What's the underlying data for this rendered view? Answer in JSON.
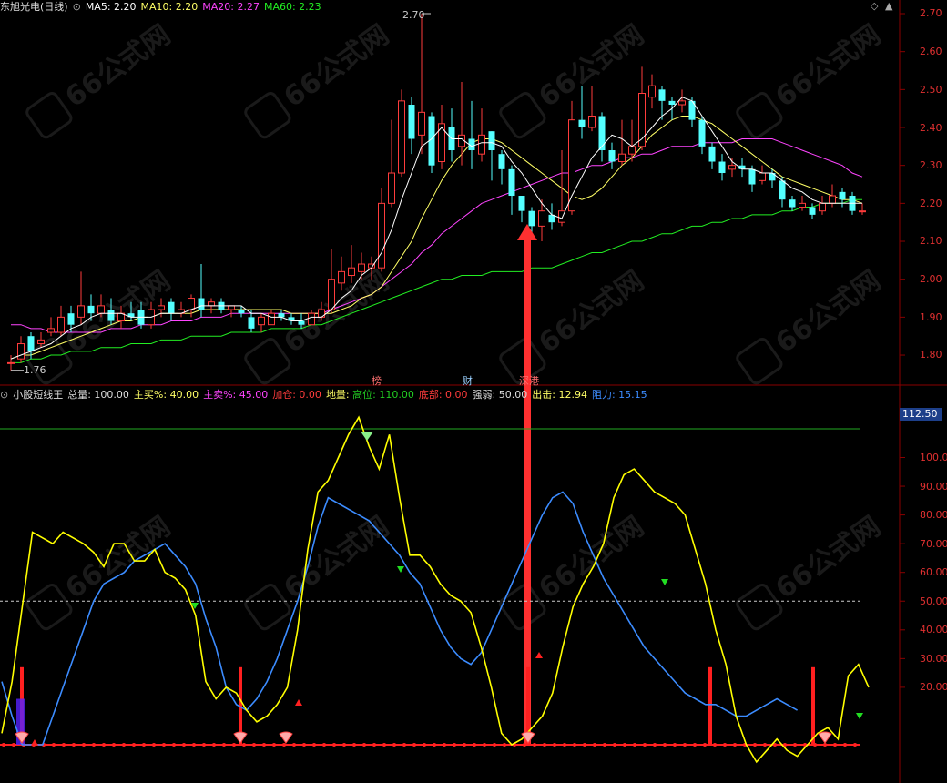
{
  "main_header": {
    "stock_name": "东旭光电(日线)",
    "ma5": "MA5: 2.20",
    "ma10": "MA10: 2.20",
    "ma20": "MA20: 2.27",
    "ma60": "MA60: 2.23"
  },
  "sub_header": {
    "indicator_name": "小股短线王",
    "total": "总量: 100.00",
    "main_buy": "主买%: 40.00",
    "main_sell": "主卖%: 45.00",
    "add_pos": "加仓: 0.00",
    "floor": "地量: ",
    "high_pos": "高位: 110.00",
    "bottom": "底部: 0.00",
    "strength": "强弱: 50.00",
    "strike": "出击: 12.94",
    "resistance": "阻力: 15.15"
  },
  "price_axis": [
    "2.70",
    "2.60",
    "2.50",
    "2.40",
    "2.30",
    "2.20",
    "2.10",
    "2.00",
    "1.90",
    "1.80"
  ],
  "indicator_axis": [
    "100.0",
    "90.00",
    "80.00",
    "70.00",
    "60.00",
    "50.00",
    "40.00",
    "30.00",
    "20.00"
  ],
  "indicator_axis_box": "112.50",
  "annotations": {
    "high_label": "2.70",
    "low_label": "1.76",
    "event_bang": "榜",
    "event_cai": "财",
    "event_tong": "深港"
  },
  "watermark_text": "66公式网",
  "colors": {
    "background": "#000000",
    "up_candle": "#ff3c3c",
    "down_candle": "#54ffff",
    "ma5": "#ffffff",
    "ma10": "#ffff66",
    "ma20": "#ff44ff",
    "ma60": "#22ee22",
    "grid": "#7a0000",
    "yellow_line": "#ffff00",
    "blue_line": "#3c8cff",
    "signal_red": "#ff2020"
  },
  "chart_data": [
    {
      "type": "candlestick",
      "name": "东旭光电(日线)",
      "ylim": [
        1.74,
        2.75
      ],
      "candles": [
        [
          1.78,
          1.78,
          1.8,
          1.76
        ],
        [
          1.79,
          1.83,
          1.85,
          1.78
        ],
        [
          1.85,
          1.81,
          1.86,
          1.79
        ],
        [
          1.83,
          1.84,
          1.86,
          1.82
        ],
        [
          1.86,
          1.87,
          1.9,
          1.85
        ],
        [
          1.86,
          1.9,
          1.93,
          1.85
        ],
        [
          1.91,
          1.88,
          1.93,
          1.86
        ],
        [
          1.9,
          1.93,
          2.02,
          1.88
        ],
        [
          1.93,
          1.91,
          1.96,
          1.89
        ],
        [
          1.91,
          1.93,
          1.96,
          1.9
        ],
        [
          1.92,
          1.89,
          1.95,
          1.88
        ],
        [
          1.89,
          1.91,
          1.93,
          1.87
        ],
        [
          1.91,
          1.9,
          1.94,
          1.89
        ],
        [
          1.92,
          1.88,
          1.94,
          1.87
        ],
        [
          1.88,
          1.92,
          1.94,
          1.87
        ],
        [
          1.92,
          1.93,
          1.95,
          1.9
        ],
        [
          1.94,
          1.91,
          1.95,
          1.89
        ],
        [
          1.91,
          1.92,
          1.94,
          1.9
        ],
        [
          1.92,
          1.95,
          1.96,
          1.9
        ],
        [
          1.95,
          1.92,
          2.04,
          1.9
        ],
        [
          1.93,
          1.94,
          1.95,
          1.91
        ],
        [
          1.94,
          1.92,
          1.95,
          1.91
        ],
        [
          1.92,
          1.93,
          1.93,
          1.9
        ],
        [
          1.92,
          1.91,
          1.93,
          1.9
        ],
        [
          1.9,
          1.87,
          1.92,
          1.86
        ],
        [
          1.88,
          1.9,
          1.91,
          1.86
        ],
        [
          1.88,
          1.91,
          1.92,
          1.88
        ],
        [
          1.91,
          1.9,
          1.92,
          1.89
        ],
        [
          1.9,
          1.89,
          1.91,
          1.88
        ],
        [
          1.89,
          1.88,
          1.91,
          1.87
        ],
        [
          1.88,
          1.91,
          1.92,
          1.88
        ],
        [
          1.9,
          1.92,
          1.94,
          1.89
        ],
        [
          1.92,
          2.0,
          2.08,
          1.91
        ],
        [
          1.99,
          2.02,
          2.06,
          1.97
        ],
        [
          2.01,
          2.03,
          2.09,
          1.99
        ],
        [
          2.02,
          2.04,
          2.07,
          2.0
        ],
        [
          2.03,
          2.04,
          2.06,
          2.0
        ],
        [
          2.03,
          2.2,
          2.24,
          2.02
        ],
        [
          2.2,
          2.28,
          2.42,
          2.19
        ],
        [
          2.28,
          2.47,
          2.5,
          2.27
        ],
        [
          2.46,
          2.37,
          2.48,
          2.33
        ],
        [
          2.38,
          2.44,
          2.7,
          2.33
        ],
        [
          2.43,
          2.3,
          2.44,
          2.28
        ],
        [
          2.31,
          2.41,
          2.46,
          2.29
        ],
        [
          2.4,
          2.34,
          2.45,
          2.31
        ],
        [
          2.35,
          2.38,
          2.52,
          2.3
        ],
        [
          2.37,
          2.34,
          2.47,
          2.29
        ],
        [
          2.33,
          2.38,
          2.45,
          2.31
        ],
        [
          2.39,
          2.34,
          2.39,
          2.26
        ],
        [
          2.33,
          2.29,
          2.34,
          2.25
        ],
        [
          2.29,
          2.22,
          2.3,
          2.17
        ],
        [
          2.22,
          2.18,
          2.22,
          2.15
        ],
        [
          2.18,
          2.14,
          2.19,
          2.12
        ],
        [
          2.14,
          2.18,
          2.21,
          2.1
        ],
        [
          2.17,
          2.15,
          2.2,
          2.13
        ],
        [
          2.15,
          2.18,
          2.34,
          2.14
        ],
        [
          2.18,
          2.42,
          2.47,
          2.17
        ],
        [
          2.42,
          2.4,
          2.51,
          2.37
        ],
        [
          2.4,
          2.43,
          2.51,
          2.39
        ],
        [
          2.43,
          2.34,
          2.44,
          2.31
        ],
        [
          2.34,
          2.31,
          2.36,
          2.29
        ],
        [
          2.31,
          2.33,
          2.42,
          2.3
        ],
        [
          2.33,
          2.35,
          2.42,
          2.31
        ],
        [
          2.35,
          2.49,
          2.56,
          2.34
        ],
        [
          2.48,
          2.51,
          2.54,
          2.45
        ],
        [
          2.5,
          2.47,
          2.51,
          2.42
        ],
        [
          2.47,
          2.46,
          2.48,
          2.42
        ],
        [
          2.46,
          2.47,
          2.5,
          2.44
        ],
        [
          2.47,
          2.42,
          2.48,
          2.4
        ],
        [
          2.42,
          2.35,
          2.43,
          2.33
        ],
        [
          2.35,
          2.31,
          2.36,
          2.29
        ],
        [
          2.31,
          2.28,
          2.33,
          2.26
        ],
        [
          2.29,
          2.3,
          2.32,
          2.27
        ],
        [
          2.3,
          2.29,
          2.32,
          2.27
        ],
        [
          2.29,
          2.25,
          2.3,
          2.23
        ],
        [
          2.26,
          2.28,
          2.3,
          2.25
        ],
        [
          2.28,
          2.26,
          2.29,
          2.24
        ],
        [
          2.26,
          2.21,
          2.27,
          2.19
        ],
        [
          2.21,
          2.19,
          2.22,
          2.18
        ],
        [
          2.19,
          2.2,
          2.22,
          2.18
        ],
        [
          2.19,
          2.17,
          2.2,
          2.16
        ],
        [
          2.18,
          2.2,
          2.22,
          2.17
        ],
        [
          2.2,
          2.22,
          2.25,
          2.19
        ],
        [
          2.23,
          2.21,
          2.24,
          2.19
        ],
        [
          2.22,
          2.18,
          2.23,
          2.17
        ],
        [
          2.18,
          2.18,
          2.2,
          2.17
        ]
      ],
      "ma5": [
        1.79,
        1.8,
        1.81,
        1.82,
        1.83,
        1.85,
        1.87,
        1.88,
        1.9,
        1.91,
        1.91,
        1.91,
        1.9,
        1.9,
        1.9,
        1.91,
        1.91,
        1.91,
        1.92,
        1.93,
        1.93,
        1.93,
        1.93,
        1.93,
        1.91,
        1.91,
        1.9,
        1.9,
        1.89,
        1.89,
        1.9,
        1.9,
        1.92,
        1.95,
        1.97,
        2.01,
        2.03,
        2.07,
        2.13,
        2.21,
        2.28,
        2.35,
        2.37,
        2.4,
        2.37,
        2.37,
        2.35,
        2.36,
        2.36,
        2.35,
        2.31,
        2.28,
        2.24,
        2.2,
        2.17,
        2.16,
        2.22,
        2.27,
        2.32,
        2.35,
        2.38,
        2.37,
        2.35,
        2.37,
        2.4,
        2.43,
        2.45,
        2.48,
        2.47,
        2.43,
        2.39,
        2.35,
        2.31,
        2.29,
        2.29,
        2.28,
        2.28,
        2.26,
        2.24,
        2.23,
        2.21,
        2.2,
        2.2,
        2.2,
        2.2,
        2.2
      ],
      "ma10": [
        1.79,
        1.8,
        1.8,
        1.81,
        1.82,
        1.83,
        1.84,
        1.85,
        1.86,
        1.87,
        1.88,
        1.89,
        1.89,
        1.9,
        1.9,
        1.91,
        1.91,
        1.91,
        1.91,
        1.92,
        1.92,
        1.92,
        1.92,
        1.92,
        1.92,
        1.92,
        1.92,
        1.92,
        1.91,
        1.91,
        1.91,
        1.91,
        1.91,
        1.92,
        1.93,
        1.95,
        1.96,
        1.98,
        2.02,
        2.06,
        2.1,
        2.16,
        2.21,
        2.26,
        2.3,
        2.33,
        2.36,
        2.37,
        2.37,
        2.36,
        2.34,
        2.32,
        2.3,
        2.28,
        2.26,
        2.24,
        2.22,
        2.21,
        2.22,
        2.24,
        2.27,
        2.3,
        2.32,
        2.35,
        2.38,
        2.4,
        2.42,
        2.43,
        2.43,
        2.42,
        2.41,
        2.39,
        2.37,
        2.35,
        2.33,
        2.31,
        2.29,
        2.27,
        2.26,
        2.25,
        2.24,
        2.23,
        2.22,
        2.21,
        2.21,
        2.2
      ],
      "ma20": [
        1.88,
        1.88,
        1.87,
        1.87,
        1.86,
        1.86,
        1.86,
        1.86,
        1.86,
        1.86,
        1.87,
        1.87,
        1.87,
        1.88,
        1.88,
        1.88,
        1.89,
        1.89,
        1.89,
        1.9,
        1.9,
        1.9,
        1.91,
        1.91,
        1.91,
        1.91,
        1.91,
        1.91,
        1.91,
        1.91,
        1.91,
        1.91,
        1.92,
        1.93,
        1.94,
        1.95,
        1.96,
        1.98,
        2.0,
        2.02,
        2.04,
        2.07,
        2.09,
        2.12,
        2.14,
        2.16,
        2.18,
        2.2,
        2.21,
        2.22,
        2.23,
        2.24,
        2.25,
        2.26,
        2.27,
        2.28,
        2.28,
        2.29,
        2.3,
        2.3,
        2.31,
        2.32,
        2.32,
        2.33,
        2.33,
        2.34,
        2.35,
        2.35,
        2.35,
        2.36,
        2.36,
        2.36,
        2.36,
        2.37,
        2.37,
        2.37,
        2.37,
        2.36,
        2.35,
        2.34,
        2.33,
        2.32,
        2.31,
        2.3,
        2.28,
        2.27
      ],
      "ma60": [
        1.78,
        1.78,
        1.79,
        1.79,
        1.8,
        1.8,
        1.81,
        1.81,
        1.81,
        1.82,
        1.82,
        1.82,
        1.83,
        1.83,
        1.83,
        1.84,
        1.84,
        1.84,
        1.85,
        1.85,
        1.85,
        1.85,
        1.86,
        1.86,
        1.86,
        1.86,
        1.87,
        1.87,
        1.87,
        1.87,
        1.88,
        1.88,
        1.89,
        1.9,
        1.91,
        1.92,
        1.93,
        1.94,
        1.95,
        1.96,
        1.97,
        1.98,
        1.99,
        2.0,
        2.0,
        2.01,
        2.01,
        2.01,
        2.02,
        2.02,
        2.02,
        2.02,
        2.03,
        2.03,
        2.03,
        2.04,
        2.05,
        2.06,
        2.07,
        2.07,
        2.08,
        2.09,
        2.1,
        2.1,
        2.11,
        2.12,
        2.12,
        2.13,
        2.14,
        2.14,
        2.15,
        2.15,
        2.16,
        2.16,
        2.17,
        2.17,
        2.17,
        2.18,
        2.18,
        2.19,
        2.19,
        2.2,
        2.2,
        2.2,
        2.21,
        2.21
      ]
    },
    {
      "type": "line",
      "name": "小股短线王",
      "ylim": [
        -10,
        115
      ],
      "horizontal_lines": [
        110,
        50,
        0
      ],
      "yellow": [
        4,
        22,
        48,
        74,
        72,
        70,
        74,
        72,
        70,
        67,
        62,
        70,
        70,
        64,
        64,
        68,
        60,
        58,
        54,
        45,
        22,
        16,
        20,
        18,
        12,
        8,
        10,
        14,
        20,
        40,
        68,
        88,
        92,
        100,
        108,
        114,
        104,
        96,
        108,
        86,
        66,
        66,
        62,
        56,
        52,
        50,
        46,
        34,
        20,
        4,
        0,
        2,
        6,
        10,
        18,
        34,
        48,
        56,
        62,
        70,
        86,
        94,
        96,
        92,
        88,
        86,
        84,
        80,
        68,
        56,
        40,
        28,
        10,
        0,
        -6,
        -2,
        2,
        -2,
        -4,
        0,
        4,
        6,
        2,
        24,
        28,
        20
      ],
      "blue": [
        22,
        10,
        0,
        0,
        0,
        10,
        20,
        30,
        40,
        50,
        56,
        58,
        60,
        64,
        66,
        68,
        70,
        66,
        62,
        56,
        44,
        34,
        20,
        14,
        12,
        16,
        22,
        30,
        40,
        50,
        62,
        76,
        86,
        84,
        82,
        80,
        78,
        74,
        70,
        66,
        60,
        56,
        48,
        40,
        34,
        30,
        28,
        32,
        40,
        48,
        56,
        64,
        72,
        80,
        86,
        88,
        84,
        74,
        66,
        58,
        52,
        46,
        40,
        34,
        30,
        26,
        22,
        18,
        16,
        14,
        14,
        12,
        10,
        10,
        12,
        14,
        16,
        14,
        12
      ]
    }
  ]
}
